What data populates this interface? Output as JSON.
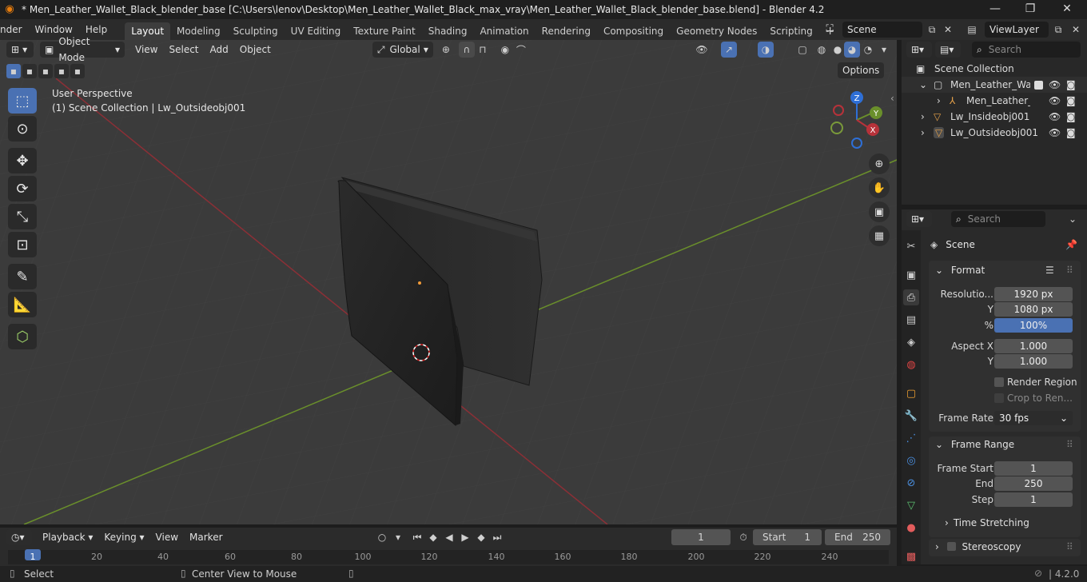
{
  "window": {
    "title": "* Men_Leather_Wallet_Black_blender_base [C:\\Users\\lenov\\Desktop\\Men_Leather_Wallet_Black_max_vray\\Men_Leather_Wallet_Black_blender_base.blend] - Blender 4.2",
    "minimize": "—",
    "restore": "❐",
    "close": "✕"
  },
  "menu": [
    "nder",
    "Window",
    "Help"
  ],
  "workspaces": [
    "Layout",
    "Modeling",
    "Sculpting",
    "UV Editing",
    "Texture Paint",
    "Shading",
    "Animation",
    "Rendering",
    "Compositing",
    "Geometry Nodes",
    "Scripting"
  ],
  "add_workspace": "+",
  "scene_field": "Scene",
  "viewlayer_field": "ViewLayer",
  "viewport": {
    "mode": "Object Mode",
    "menus": [
      "View",
      "Select",
      "Add",
      "Object"
    ],
    "transform_orientation": "Global",
    "options": "Options",
    "overlay_line1": "User Perspective",
    "overlay_line2": "(1) Scene Collection | Lw_Outsideobj001",
    "gizmo": {
      "z": "Z",
      "y": "Y",
      "x": "X"
    }
  },
  "outliner": {
    "search_placeholder": "Search",
    "root": "Scene Collection",
    "items": [
      {
        "label": "Men_Leather_Walle",
        "indent": 1
      },
      {
        "label": "Men_Leather_W",
        "indent": 2
      },
      {
        "label": "Lw_Insideobj001",
        "indent": 1
      },
      {
        "label": "Lw_Outsideobj001",
        "indent": 1
      }
    ]
  },
  "properties": {
    "search_placeholder": "Search",
    "context": "Scene",
    "format_title": "Format",
    "resolution_x_label": "Resolutio...",
    "resolution_x": "1920 px",
    "resolution_y_label": "Y",
    "resolution_y": "1080 px",
    "percent_label": "%",
    "percent": "100%",
    "percent_value": 100,
    "aspect_x_label": "Aspect X",
    "aspect_x": "1.000",
    "aspect_y_label": "Y",
    "aspect_y": "1.000",
    "render_region": "Render Region",
    "crop": "Crop to Ren...",
    "frame_rate_label": "Frame Rate",
    "frame_rate": "30 fps",
    "frame_range_title": "Frame Range",
    "frame_start_label": "Frame Start",
    "frame_start": "1",
    "end_label": "End",
    "end": "250",
    "step_label": "Step",
    "step": "1",
    "time_stretching": "Time Stretching",
    "stereoscopy": "Stereoscopy"
  },
  "timeline": {
    "menus": [
      "Playback",
      "Keying",
      "View",
      "Marker"
    ],
    "current_frame": "1",
    "start_label": "Start",
    "start": "1",
    "end_label": "End",
    "end": "250",
    "ruler": [
      "1",
      "20",
      "40",
      "60",
      "80",
      "100",
      "120",
      "140",
      "160",
      "180",
      "200",
      "220",
      "240"
    ]
  },
  "status": {
    "select": "Select",
    "center_view": "Center View to Mouse",
    "version": "4.2.0"
  },
  "colors": {
    "accent": "#4a71b3",
    "x_axis": "#b7323a",
    "y_axis": "#6a8f2b",
    "z_axis": "#2e6fd6"
  }
}
